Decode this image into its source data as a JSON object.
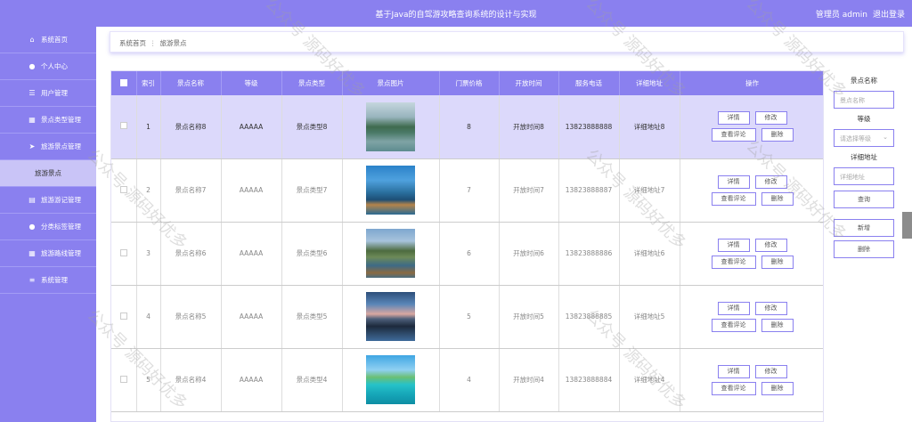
{
  "header": {
    "title": "基于Java的自驾游攻略查询系统的设计与实现",
    "user": "管理员 admin",
    "logout": "退出登录"
  },
  "sidebar": {
    "items": [
      {
        "label": "系统首页",
        "icon": "home-icon"
      },
      {
        "label": "个人中心",
        "icon": "user-icon"
      },
      {
        "label": "用户管理",
        "icon": "sliders-icon"
      },
      {
        "label": "景点类型管理",
        "icon": "grid-icon"
      },
      {
        "label": "旅游景点管理",
        "icon": "send-icon"
      },
      {
        "label": "旅游景点",
        "icon": ""
      },
      {
        "label": "旅游游记管理",
        "icon": "clipboard-icon"
      },
      {
        "label": "分类标签管理",
        "icon": "pin-icon"
      },
      {
        "label": "旅游路线管理",
        "icon": "grid-icon"
      },
      {
        "label": "系统管理",
        "icon": "menu-icon"
      }
    ]
  },
  "breadcrumb": {
    "home": "系统首页",
    "sep": "⋮",
    "current": "旅游景点"
  },
  "table": {
    "headers": [
      "索引",
      "景点名称",
      "等级",
      "景点类型",
      "景点图片",
      "门票价格",
      "开放时间",
      "服务电话",
      "详细地址",
      "操作"
    ],
    "rows": [
      {
        "idx": "1",
        "name": "景点名称8",
        "level": "AAAAA",
        "type": "景点类型8",
        "price": "8",
        "time": "开放时间8",
        "phone": "13823888888",
        "addr": "详细地址8"
      },
      {
        "idx": "2",
        "name": "景点名称7",
        "level": "AAAAA",
        "type": "景点类型7",
        "price": "7",
        "time": "开放时间7",
        "phone": "13823888887",
        "addr": "详细地址7"
      },
      {
        "idx": "3",
        "name": "景点名称6",
        "level": "AAAAA",
        "type": "景点类型6",
        "price": "6",
        "time": "开放时间6",
        "phone": "13823888886",
        "addr": "详细地址6"
      },
      {
        "idx": "4",
        "name": "景点名称5",
        "level": "AAAAA",
        "type": "景点类型5",
        "price": "5",
        "time": "开放时间5",
        "phone": "13823888885",
        "addr": "详细地址5"
      },
      {
        "idx": "5",
        "name": "景点名称4",
        "level": "AAAAA",
        "type": "景点类型4",
        "price": "4",
        "time": "开放时间4",
        "phone": "13823888884",
        "addr": "详细地址4"
      }
    ],
    "ops": {
      "detail": "详情",
      "edit": "修改",
      "comments": "查看评论",
      "delete": "删除"
    }
  },
  "search": {
    "name_label": "景点名称",
    "name_placeholder": "景点名称",
    "level_label": "等级",
    "level_placeholder": "请选择等级",
    "addr_label": "详细地址",
    "addr_placeholder": "详细地址",
    "query": "查询",
    "add": "新增",
    "delete": "删除"
  },
  "watermark": "公众号 源码好优多",
  "colors": {
    "primary": "#8a80ef",
    "selected_row": "#dcd9fb"
  }
}
